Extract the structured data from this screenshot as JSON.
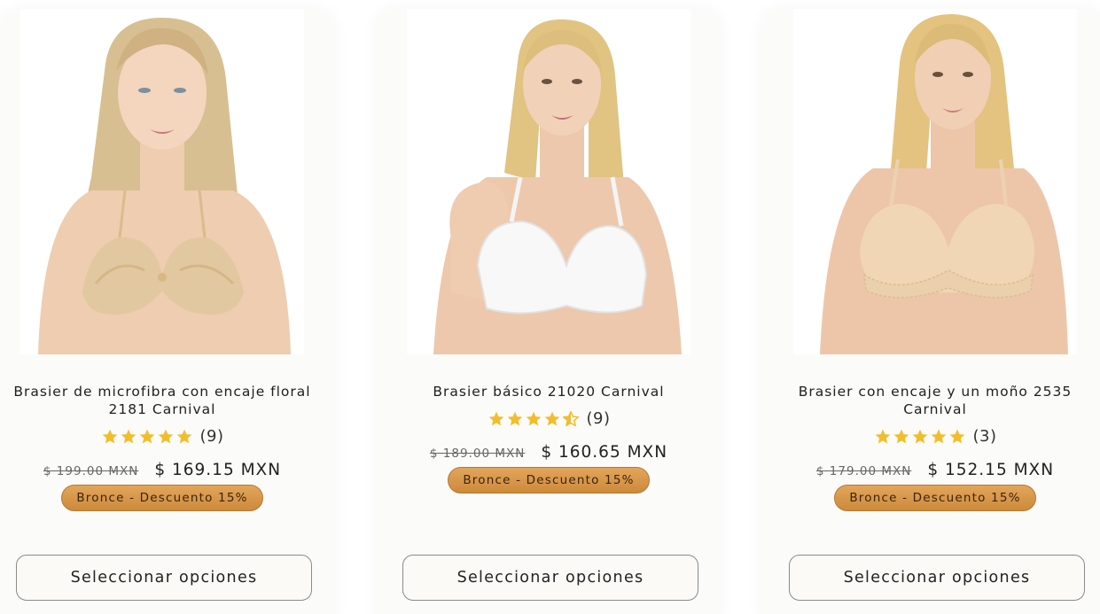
{
  "colors": {
    "star": "#f3bd2a",
    "badge": "#d9983f",
    "button_border": "#8a8a8a"
  },
  "products": [
    {
      "title_line1": "Brasier de microfibra con encaje floral",
      "title_line2": "2181 Carnival",
      "rating": 5,
      "reviews": "(9)",
      "old_price": "$ 199.00 MXN",
      "new_price": "$ 169.15 MXN",
      "badge": "Bronce - Descuento 15%",
      "button": "Seleccionar opciones",
      "garment": "beige lace bra"
    },
    {
      "title_line1": "Brasier básico 21020 Carnival",
      "title_line2": "",
      "rating": 4.5,
      "reviews": "(9)",
      "old_price": "$ 189.00 MXN",
      "new_price": "$ 160.65 MXN",
      "badge": "Bronce - Descuento 15%",
      "button": "Seleccionar opciones",
      "garment": "white bra"
    },
    {
      "title_line1": "Brasier con encaje y un moño 2535",
      "title_line2": "Carnival",
      "rating": 5,
      "reviews": "(3)",
      "old_price": "$ 179.00 MXN",
      "new_price": "$ 152.15 MXN",
      "badge": "Bronce - Descuento 15%",
      "button": "Seleccionar opciones",
      "garment": "nude bra with lace"
    }
  ]
}
